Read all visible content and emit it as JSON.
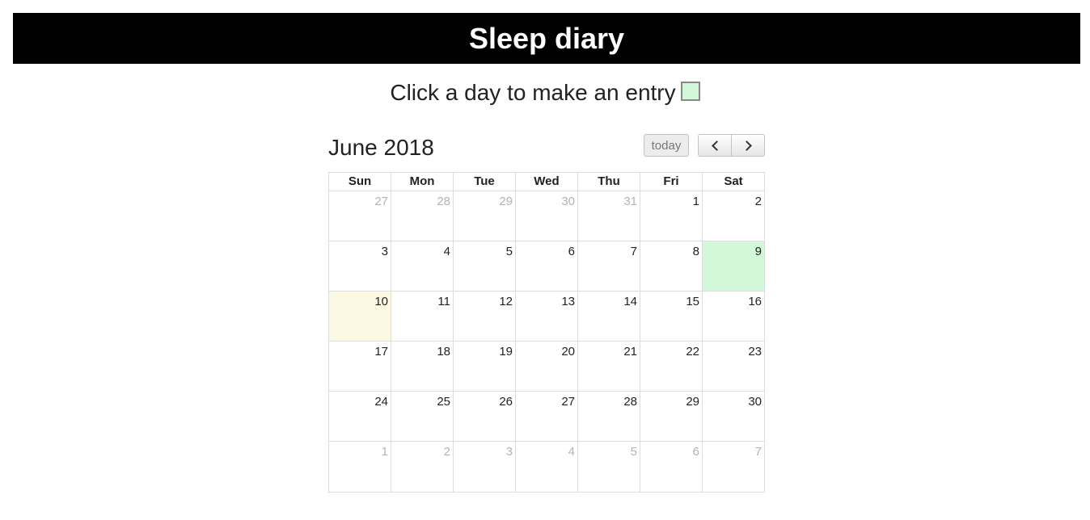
{
  "header": {
    "title": "Sleep diary"
  },
  "instruction": {
    "text": "Click a day to make an entry"
  },
  "legend": {
    "entry_color": "#d3f8d9",
    "icon": "entry-legend-swatch"
  },
  "calendar": {
    "title": "June 2018",
    "today_label": "today",
    "prev_icon": "chevron-left-icon",
    "next_icon": "chevron-right-icon",
    "weekdays": [
      "Sun",
      "Mon",
      "Tue",
      "Wed",
      "Thu",
      "Fri",
      "Sat"
    ],
    "colors": {
      "today": "#fcf8e3",
      "entry": "#d3f8d9",
      "other_month_text": "#b3b3b3"
    },
    "weeks": [
      [
        {
          "n": "27",
          "other": true
        },
        {
          "n": "28",
          "other": true
        },
        {
          "n": "29",
          "other": true
        },
        {
          "n": "30",
          "other": true
        },
        {
          "n": "31",
          "other": true
        },
        {
          "n": "1"
        },
        {
          "n": "2"
        }
      ],
      [
        {
          "n": "3"
        },
        {
          "n": "4"
        },
        {
          "n": "5"
        },
        {
          "n": "6"
        },
        {
          "n": "7"
        },
        {
          "n": "8"
        },
        {
          "n": "9",
          "entry": true
        }
      ],
      [
        {
          "n": "10",
          "today": true
        },
        {
          "n": "11"
        },
        {
          "n": "12"
        },
        {
          "n": "13"
        },
        {
          "n": "14"
        },
        {
          "n": "15"
        },
        {
          "n": "16"
        }
      ],
      [
        {
          "n": "17"
        },
        {
          "n": "18"
        },
        {
          "n": "19"
        },
        {
          "n": "20"
        },
        {
          "n": "21"
        },
        {
          "n": "22"
        },
        {
          "n": "23"
        }
      ],
      [
        {
          "n": "24"
        },
        {
          "n": "25"
        },
        {
          "n": "26"
        },
        {
          "n": "27"
        },
        {
          "n": "28"
        },
        {
          "n": "29"
        },
        {
          "n": "30"
        }
      ],
      [
        {
          "n": "1",
          "other": true
        },
        {
          "n": "2",
          "other": true
        },
        {
          "n": "3",
          "other": true
        },
        {
          "n": "4",
          "other": true
        },
        {
          "n": "5",
          "other": true
        },
        {
          "n": "6",
          "other": true
        },
        {
          "n": "7",
          "other": true
        }
      ]
    ]
  }
}
